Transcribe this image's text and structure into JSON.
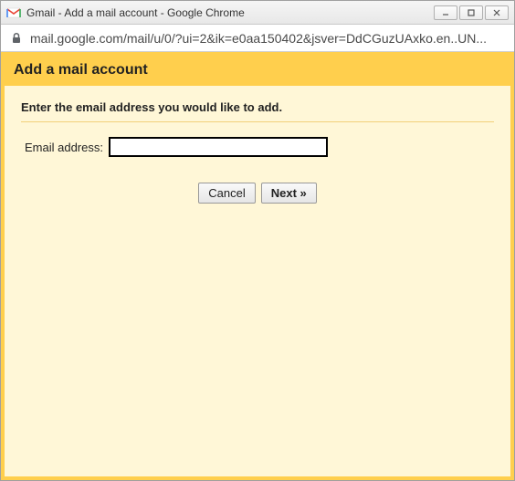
{
  "window": {
    "title": "Gmail - Add a mail account - Google Chrome"
  },
  "addressbar": {
    "url": "mail.google.com/mail/u/0/?ui=2&ik=e0aa150402&jsver=DdCGuzUAxko.en..UN..."
  },
  "page": {
    "heading": "Add a mail account",
    "instruction": "Enter the email address you would like to add.",
    "email_label": "Email address:",
    "email_value": "",
    "cancel_label": "Cancel",
    "next_label": "Next »"
  }
}
